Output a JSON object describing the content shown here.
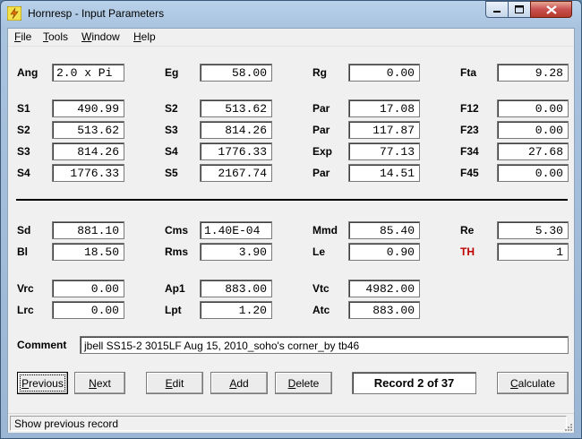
{
  "window": {
    "title": "Hornresp - Input Parameters"
  },
  "menu": [
    {
      "label": "File",
      "accel": "F",
      "rest": "ile"
    },
    {
      "label": "Tools",
      "accel": "T",
      "rest": "ools"
    },
    {
      "label": "Window",
      "accel": "W",
      "rest": "indow"
    },
    {
      "label": "Help",
      "accel": "H",
      "rest": "elp"
    }
  ],
  "params": {
    "ang": {
      "label": "Ang",
      "value": "2.0 x Pi"
    },
    "eg": {
      "label": "Eg",
      "value": "58.00"
    },
    "rg": {
      "label": "Rg",
      "value": "0.00"
    },
    "fta": {
      "label": "Fta",
      "value": "9.28"
    },
    "s1": {
      "label": "S1",
      "value": "490.99"
    },
    "s2a": {
      "label": "S2",
      "value": "513.62"
    },
    "par1": {
      "label": "Par",
      "value": "17.08"
    },
    "f12": {
      "label": "F12",
      "value": "0.00"
    },
    "s2b": {
      "label": "S2",
      "value": "513.62"
    },
    "s3a": {
      "label": "S3",
      "value": "814.26"
    },
    "par2": {
      "label": "Par",
      "value": "117.87"
    },
    "f23": {
      "label": "F23",
      "value": "0.00"
    },
    "s3b": {
      "label": "S3",
      "value": "814.26"
    },
    "s4a": {
      "label": "S4",
      "value": "1776.33"
    },
    "exp": {
      "label": "Exp",
      "value": "77.13"
    },
    "f34": {
      "label": "F34",
      "value": "27.68"
    },
    "s4b": {
      "label": "S4",
      "value": "1776.33"
    },
    "s5": {
      "label": "S5",
      "value": "2167.74"
    },
    "par3": {
      "label": "Par",
      "value": "14.51"
    },
    "f45": {
      "label": "F45",
      "value": "0.00"
    },
    "sd": {
      "label": "Sd",
      "value": "881.10"
    },
    "cms": {
      "label": "Cms",
      "value": "1.40E-04"
    },
    "mmd": {
      "label": "Mmd",
      "value": "85.40"
    },
    "re": {
      "label": "Re",
      "value": "5.30"
    },
    "bl": {
      "label": "Bl",
      "value": "18.50"
    },
    "rms": {
      "label": "Rms",
      "value": "3.90"
    },
    "le": {
      "label": "Le",
      "value": "0.90"
    },
    "th": {
      "label": "TH",
      "value": "1"
    },
    "vrc": {
      "label": "Vrc",
      "value": "0.00"
    },
    "ap1": {
      "label": "Ap1",
      "value": "883.00"
    },
    "vtc": {
      "label": "Vtc",
      "value": "4982.00"
    },
    "lrc": {
      "label": "Lrc",
      "value": "0.00"
    },
    "lpt": {
      "label": "Lpt",
      "value": "1.20"
    },
    "atc": {
      "label": "Atc",
      "value": "883.00"
    }
  },
  "comment": {
    "label": "Comment",
    "value": "jbell SS15-2 3015LF Aug 15, 2010_soho's corner_by tb46"
  },
  "buttons": {
    "previous": {
      "accel": "P",
      "rest": "revious"
    },
    "next": {
      "accel": "N",
      "rest": "ext"
    },
    "edit": {
      "accel": "E",
      "rest": "dit"
    },
    "add": {
      "accel": "A",
      "rest": "dd"
    },
    "delete": {
      "accel": "D",
      "rest": "elete"
    },
    "calculate": {
      "accel": "C",
      "rest": "alculate"
    }
  },
  "record": "Record 2 of 37",
  "status": "Show previous record",
  "colors": {
    "th_label": "#c00000",
    "title_gradient_top": "#b9d1ea",
    "close_button": "#c75050"
  }
}
